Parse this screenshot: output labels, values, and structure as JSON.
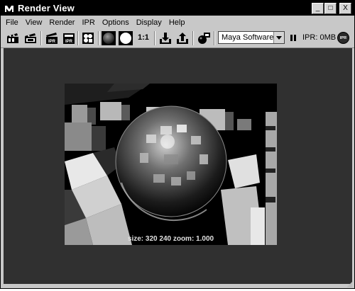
{
  "window": {
    "title": "Render View",
    "icon": "maya-logo-icon",
    "buttons": {
      "minimize": "_",
      "maximize": "□",
      "close": "X"
    }
  },
  "menu": {
    "items": [
      "File",
      "View",
      "Render",
      "IPR",
      "Options",
      "Display",
      "Help"
    ]
  },
  "toolbar": {
    "one_to_one_label": "1:1",
    "renderer": "Maya Software",
    "ipr_memory": "IPR: 0MB",
    "ipr_badge": "IPR",
    "icons": [
      "redo-render-icon",
      "render-region-icon",
      "ipr-render-icon",
      "refresh-ipr-icon",
      "render-settings-icon",
      "rgb-channels-icon",
      "alpha-channel-icon",
      "real-size-icon",
      "keep-image-icon",
      "remove-image-icon",
      "snapshot-icon",
      "pause-icon",
      "ipr-memory-icon"
    ]
  },
  "render": {
    "info_label": "size:  320  240 zoom: 1.000"
  }
}
